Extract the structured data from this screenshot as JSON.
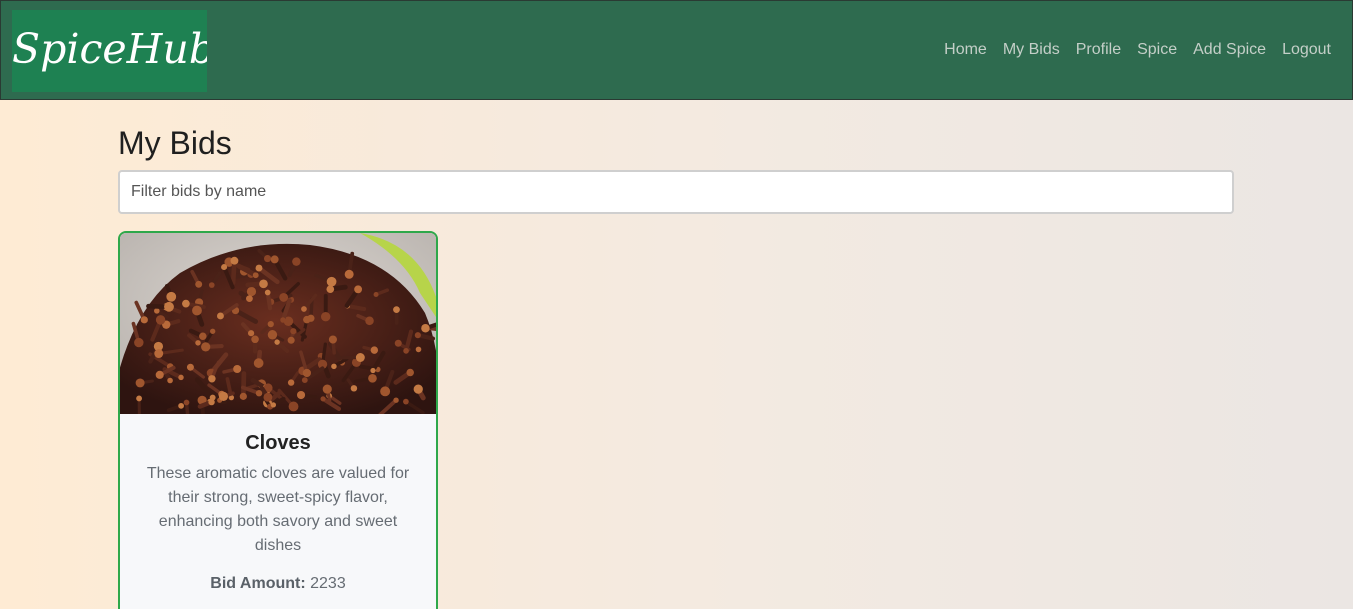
{
  "brand": {
    "name": "SpiceHub"
  },
  "nav": {
    "items": [
      {
        "label": "Home"
      },
      {
        "label": "My Bids"
      },
      {
        "label": "Profile"
      },
      {
        "label": "Spice"
      },
      {
        "label": "Add Spice"
      },
      {
        "label": "Logout"
      }
    ]
  },
  "page": {
    "title": "My Bids",
    "filter_placeholder": "Filter bids by name"
  },
  "bids": [
    {
      "name": "Cloves",
      "description": "These aromatic cloves are valued for their strong, sweet-spicy flavor, enhancing both savory and sweet dishes",
      "bid_label": "Bid Amount:",
      "bid_amount": "2233"
    }
  ],
  "colors": {
    "navbar": "#2e6b4f",
    "brand_bg": "#1e8152",
    "card_border": "#2ea84a"
  }
}
